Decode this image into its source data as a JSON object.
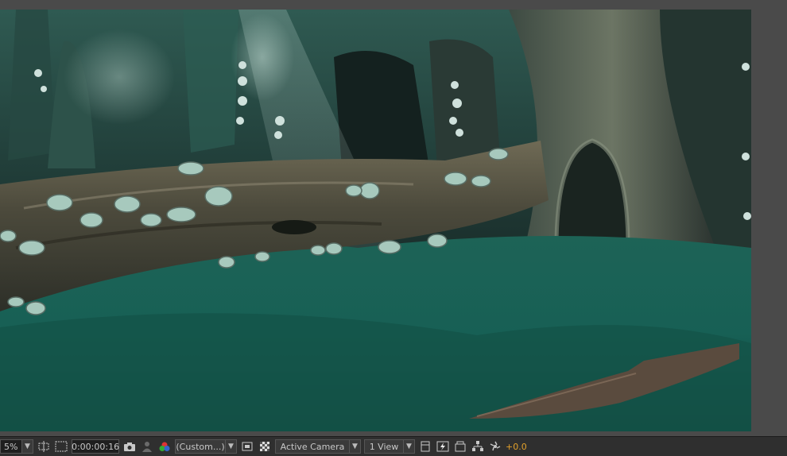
{
  "toolbar": {
    "zoom": "5%",
    "timecode": "0:00:00:16",
    "resolution": "(Custom...)",
    "camera": "Active Camera",
    "views": "1 View",
    "exposure": "+0.0"
  },
  "colors": {
    "accent": "#e3a12b",
    "panel": "#2f2f2f",
    "viewer_bg": "#4a4a4a"
  },
  "icons": [
    "region-of-interest-icon",
    "transparency-grid-icon",
    "snapshot-camera-icon",
    "show-snapshot-icon",
    "color-channels-icon",
    "toggle-mask-icon",
    "checkerboard-icon",
    "fast-preview-icon",
    "flowchart-icon",
    "reset-exposure-icon",
    "pixel-aspect-icon",
    "3d-renderer-icon"
  ]
}
